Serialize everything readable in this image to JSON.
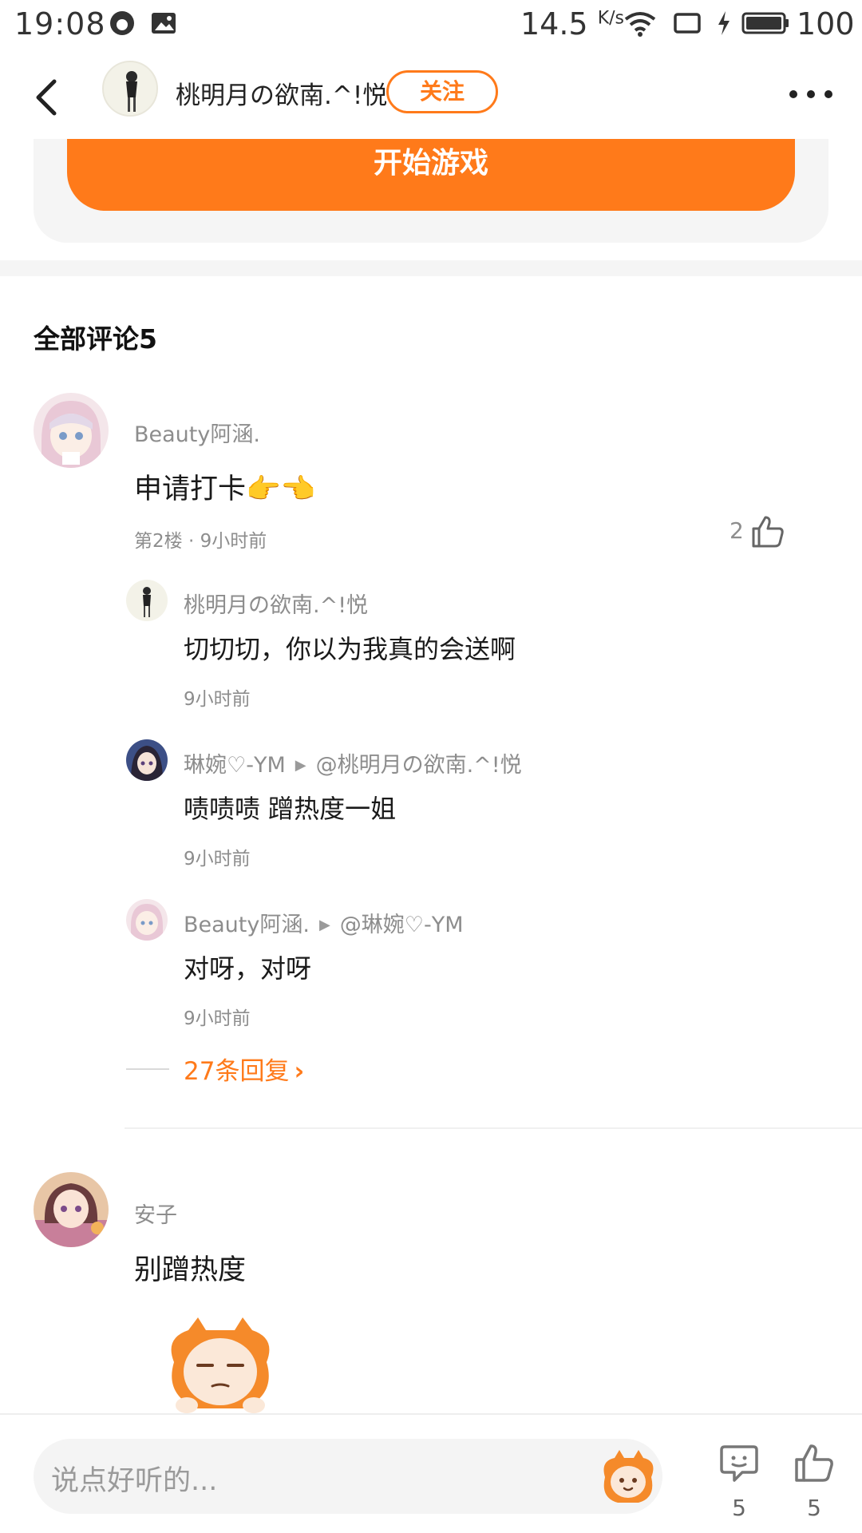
{
  "status_bar": {
    "time": "19:08",
    "net_speed": "14.5",
    "net_speed_unit": "K/s",
    "battery": "100"
  },
  "header": {
    "username": "桃明月の欲南.^!悦",
    "follow_label": "关注"
  },
  "game_card": {
    "start_label": "开始游戏"
  },
  "comments_section": {
    "title": "全部评论5"
  },
  "comments": [
    {
      "username": "Beauty阿涵.",
      "text": "申请打卡👉👈",
      "meta": "第2楼 · 9小时前",
      "likes": "2",
      "replies": [
        {
          "username": "桃明月の欲南.^!悦",
          "reply_to": "",
          "text": "切切切，你以为我真的会送啊",
          "time": "9小时前"
        },
        {
          "username": "琳婉♡-YM",
          "reply_to": "@桃明月の欲南.^!悦",
          "text": "啧啧啧 蹭热度一姐",
          "time": "9小时前"
        },
        {
          "username": "Beauty阿涵.",
          "reply_to": "@琳婉♡-YM",
          "text": "对呀，对呀",
          "time": "9小时前"
        }
      ],
      "more_replies_label": "27条回复"
    },
    {
      "username": "安子",
      "text": "别蹭热度"
    }
  ],
  "bottom_bar": {
    "input_placeholder": "说点好听的...",
    "comment_count": "5",
    "like_count": "5"
  },
  "colors": {
    "accent": "#ff7a1a",
    "muted_text": "#8d8d8d",
    "card_bg": "#f5f5f5"
  },
  "icons": [
    "back-arrow-icon",
    "more-dots-icon",
    "thumbs-up-icon",
    "comment-bubble-icon",
    "wifi-icon",
    "battery-icon",
    "mascot-sticker-icon"
  ]
}
